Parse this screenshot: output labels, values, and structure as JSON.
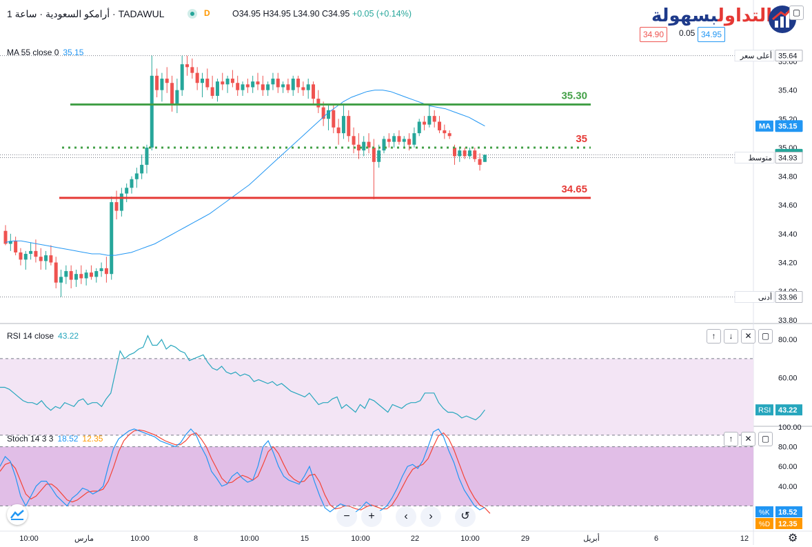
{
  "header": {
    "symbol_line": "أرامكو السعودية · ساعة 1 · TADAWUL",
    "status_letter": "D",
    "ohlc": {
      "o": "O34.95",
      "h": "H34.95",
      "l": "L34.90",
      "c": "C34.95",
      "chg": "+0.05 (+0.14%)"
    },
    "bid": "34.90",
    "spread": "0.05",
    "ask": "34.95",
    "logo_red": "التداول",
    "logo_blue": "بسهولة"
  },
  "colors": {
    "up": "#26a69a",
    "down": "#ef5350",
    "ma": "#2196f3",
    "rsi": "#26a6bd",
    "stoch_k": "#2196f3",
    "stoch_d": "#f44336",
    "green_line": "#43a047",
    "red_line": "#e53935",
    "band": "#e1bee7"
  },
  "legends": {
    "ma": {
      "label": "MA 55 close 0",
      "value": "35.15"
    },
    "rsi": {
      "label": "RSI 14 close",
      "value": "43.22"
    },
    "stoch": {
      "label": "Stoch 14 3 3",
      "k": "18.52",
      "d": "12.35"
    }
  },
  "price_axis_labels": {
    "high": "أعلى سعر",
    "avg": "متوسط",
    "low": "أدنى"
  },
  "chart_data": [
    {
      "type": "candlestick",
      "title": "",
      "ylim": [
        33.78,
        35.72
      ],
      "y_ticks": [
        33.8,
        34.0,
        34.2,
        34.4,
        34.6,
        34.8,
        35.0,
        35.2,
        35.4,
        35.6
      ],
      "x_tick_labels": [
        "10:00",
        "مارس",
        "10:00",
        "8",
        "10:00",
        "15",
        "10:00",
        "22",
        "10:00",
        "29",
        "أبريل",
        "6",
        "12"
      ],
      "bars": [
        {
          "o": 34.42,
          "h": 34.46,
          "l": 34.32,
          "c": 34.33
        },
        {
          "o": 34.33,
          "h": 34.4,
          "l": 34.28,
          "c": 34.35
        },
        {
          "o": 34.35,
          "h": 34.38,
          "l": 34.25,
          "c": 34.27
        },
        {
          "o": 34.27,
          "h": 34.3,
          "l": 34.18,
          "c": 34.22
        },
        {
          "o": 34.22,
          "h": 34.28,
          "l": 34.15,
          "c": 34.26
        },
        {
          "o": 34.26,
          "h": 34.34,
          "l": 34.22,
          "c": 34.28
        },
        {
          "o": 34.28,
          "h": 34.36,
          "l": 34.2,
          "c": 34.24
        },
        {
          "o": 34.24,
          "h": 34.3,
          "l": 34.15,
          "c": 34.21
        },
        {
          "o": 34.21,
          "h": 34.28,
          "l": 34.15,
          "c": 34.25
        },
        {
          "o": 34.25,
          "h": 34.32,
          "l": 34.18,
          "c": 34.2
        },
        {
          "o": 34.2,
          "h": 34.24,
          "l": 34.02,
          "c": 34.06
        },
        {
          "o": 34.06,
          "h": 34.15,
          "l": 33.96,
          "c": 34.1
        },
        {
          "o": 34.1,
          "h": 34.18,
          "l": 34.05,
          "c": 34.14
        },
        {
          "o": 34.14,
          "h": 34.18,
          "l": 34.02,
          "c": 34.08
        },
        {
          "o": 34.08,
          "h": 34.15,
          "l": 34.03,
          "c": 34.12
        },
        {
          "o": 34.12,
          "h": 34.18,
          "l": 34.05,
          "c": 34.09
        },
        {
          "o": 34.09,
          "h": 34.15,
          "l": 34.04,
          "c": 34.13
        },
        {
          "o": 34.13,
          "h": 34.18,
          "l": 34.08,
          "c": 34.1
        },
        {
          "o": 34.1,
          "h": 34.16,
          "l": 34.06,
          "c": 34.14
        },
        {
          "o": 34.14,
          "h": 34.2,
          "l": 34.1,
          "c": 34.16
        },
        {
          "o": 34.16,
          "h": 34.24,
          "l": 34.06,
          "c": 34.12
        },
        {
          "o": 34.12,
          "h": 34.66,
          "l": 34.08,
          "c": 34.62
        },
        {
          "o": 34.62,
          "h": 34.7,
          "l": 34.5,
          "c": 34.56
        },
        {
          "o": 34.56,
          "h": 34.72,
          "l": 34.52,
          "c": 34.68
        },
        {
          "o": 34.68,
          "h": 34.75,
          "l": 34.62,
          "c": 34.72
        },
        {
          "o": 34.72,
          "h": 34.8,
          "l": 34.68,
          "c": 34.78
        },
        {
          "o": 34.78,
          "h": 34.86,
          "l": 34.72,
          "c": 34.82
        },
        {
          "o": 34.82,
          "h": 34.95,
          "l": 34.78,
          "c": 34.88
        },
        {
          "o": 34.88,
          "h": 35.02,
          "l": 34.82,
          "c": 35.0
        },
        {
          "o": 35.0,
          "h": 35.64,
          "l": 34.98,
          "c": 35.5
        },
        {
          "o": 35.5,
          "h": 35.55,
          "l": 35.35,
          "c": 35.4
        },
        {
          "o": 35.4,
          "h": 35.52,
          "l": 35.32,
          "c": 35.48
        },
        {
          "o": 35.48,
          "h": 35.56,
          "l": 35.38,
          "c": 35.45
        },
        {
          "o": 35.45,
          "h": 35.5,
          "l": 35.25,
          "c": 35.3
        },
        {
          "o": 35.3,
          "h": 35.48,
          "l": 35.24,
          "c": 35.4
        },
        {
          "o": 35.4,
          "h": 35.64,
          "l": 35.36,
          "c": 35.58
        },
        {
          "o": 35.58,
          "h": 35.64,
          "l": 35.5,
          "c": 35.56
        },
        {
          "o": 35.56,
          "h": 35.62,
          "l": 35.48,
          "c": 35.52
        },
        {
          "o": 35.52,
          "h": 35.56,
          "l": 35.4,
          "c": 35.45
        },
        {
          "o": 35.45,
          "h": 35.52,
          "l": 35.35,
          "c": 35.48
        },
        {
          "o": 35.48,
          "h": 35.55,
          "l": 35.4,
          "c": 35.42
        },
        {
          "o": 35.42,
          "h": 35.5,
          "l": 35.34,
          "c": 35.36
        },
        {
          "o": 35.36,
          "h": 35.48,
          "l": 35.32,
          "c": 35.46
        },
        {
          "o": 35.46,
          "h": 35.52,
          "l": 35.4,
          "c": 35.44
        },
        {
          "o": 35.44,
          "h": 35.5,
          "l": 35.38,
          "c": 35.48
        },
        {
          "o": 35.48,
          "h": 35.54,
          "l": 35.42,
          "c": 35.45
        },
        {
          "o": 35.45,
          "h": 35.5,
          "l": 35.36,
          "c": 35.4
        },
        {
          "o": 35.4,
          "h": 35.46,
          "l": 35.36,
          "c": 35.44
        },
        {
          "o": 35.44,
          "h": 35.48,
          "l": 35.38,
          "c": 35.42
        },
        {
          "o": 35.42,
          "h": 35.5,
          "l": 35.38,
          "c": 35.46
        },
        {
          "o": 35.46,
          "h": 35.52,
          "l": 35.4,
          "c": 35.44
        },
        {
          "o": 35.44,
          "h": 35.5,
          "l": 35.36,
          "c": 35.4
        },
        {
          "o": 35.4,
          "h": 35.46,
          "l": 35.36,
          "c": 35.44
        },
        {
          "o": 35.44,
          "h": 35.52,
          "l": 35.4,
          "c": 35.48
        },
        {
          "o": 35.48,
          "h": 35.52,
          "l": 35.38,
          "c": 35.42
        },
        {
          "o": 35.42,
          "h": 35.46,
          "l": 35.38,
          "c": 35.44
        },
        {
          "o": 35.44,
          "h": 35.48,
          "l": 35.38,
          "c": 35.4
        },
        {
          "o": 35.4,
          "h": 35.5,
          "l": 35.36,
          "c": 35.48
        },
        {
          "o": 35.48,
          "h": 35.5,
          "l": 35.38,
          "c": 35.42
        },
        {
          "o": 35.42,
          "h": 35.46,
          "l": 35.36,
          "c": 35.4
        },
        {
          "o": 35.4,
          "h": 35.48,
          "l": 35.34,
          "c": 35.44
        },
        {
          "o": 35.44,
          "h": 35.46,
          "l": 35.3,
          "c": 35.34
        },
        {
          "o": 35.34,
          "h": 35.4,
          "l": 35.24,
          "c": 35.28
        },
        {
          "o": 35.28,
          "h": 35.32,
          "l": 35.15,
          "c": 35.2
        },
        {
          "o": 35.2,
          "h": 35.3,
          "l": 35.12,
          "c": 35.26
        },
        {
          "o": 35.26,
          "h": 35.3,
          "l": 35.1,
          "c": 35.14
        },
        {
          "o": 35.14,
          "h": 35.2,
          "l": 35.02,
          "c": 35.1
        },
        {
          "o": 35.1,
          "h": 35.3,
          "l": 35.06,
          "c": 35.22
        },
        {
          "o": 35.22,
          "h": 35.26,
          "l": 35.04,
          "c": 35.08
        },
        {
          "o": 35.08,
          "h": 35.14,
          "l": 34.96,
          "c": 35.02
        },
        {
          "o": 35.02,
          "h": 35.1,
          "l": 34.92,
          "c": 34.98
        },
        {
          "o": 34.98,
          "h": 35.08,
          "l": 34.94,
          "c": 35.04
        },
        {
          "o": 35.04,
          "h": 35.1,
          "l": 34.96,
          "c": 35.0
        },
        {
          "o": 35.0,
          "h": 35.06,
          "l": 34.64,
          "c": 34.9
        },
        {
          "o": 34.9,
          "h": 35.02,
          "l": 34.86,
          "c": 34.98
        },
        {
          "o": 34.98,
          "h": 35.08,
          "l": 34.96,
          "c": 35.06
        },
        {
          "o": 35.06,
          "h": 35.1,
          "l": 35.0,
          "c": 35.04
        },
        {
          "o": 35.04,
          "h": 35.1,
          "l": 35.0,
          "c": 35.08
        },
        {
          "o": 35.08,
          "h": 35.12,
          "l": 35.02,
          "c": 35.04
        },
        {
          "o": 35.04,
          "h": 35.08,
          "l": 35.0,
          "c": 35.06
        },
        {
          "o": 35.06,
          "h": 35.1,
          "l": 34.98,
          "c": 35.02
        },
        {
          "o": 35.02,
          "h": 35.14,
          "l": 35.0,
          "c": 35.1
        },
        {
          "o": 35.1,
          "h": 35.2,
          "l": 35.08,
          "c": 35.18
        },
        {
          "o": 35.18,
          "h": 35.22,
          "l": 35.12,
          "c": 35.16
        },
        {
          "o": 35.16,
          "h": 35.3,
          "l": 35.14,
          "c": 35.22
        },
        {
          "o": 35.22,
          "h": 35.26,
          "l": 35.14,
          "c": 35.18
        },
        {
          "o": 35.18,
          "h": 35.22,
          "l": 35.1,
          "c": 35.12
        },
        {
          "o": 35.12,
          "h": 35.16,
          "l": 35.06,
          "c": 35.1
        },
        {
          "o": 35.1,
          "h": 35.12,
          "l": 35.06,
          "c": 35.08
        },
        {
          "o": 35.0,
          "h": 35.02,
          "l": 34.88,
          "c": 34.94
        },
        {
          "o": 34.94,
          "h": 35.0,
          "l": 34.9,
          "c": 34.98
        },
        {
          "o": 34.98,
          "h": 35.0,
          "l": 34.92,
          "c": 34.94
        },
        {
          "o": 34.94,
          "h": 35.0,
          "l": 34.92,
          "c": 34.98
        },
        {
          "o": 34.98,
          "h": 35.0,
          "l": 34.9,
          "c": 34.92
        },
        {
          "o": 34.92,
          "h": 34.96,
          "l": 34.84,
          "c": 34.88
        },
        {
          "o": 34.9,
          "h": 34.95,
          "l": 34.9,
          "c": 34.95
        }
      ],
      "ma55": [
        34.34,
        34.35,
        34.35,
        34.34,
        34.33,
        34.32,
        34.31,
        34.3,
        34.29,
        34.28,
        34.27,
        34.26,
        34.26,
        34.25,
        34.25,
        34.26,
        34.27,
        34.29,
        34.31,
        34.33,
        34.36,
        34.39,
        34.42,
        34.45,
        34.48,
        34.51,
        34.54,
        34.58,
        34.62,
        34.66,
        34.7,
        34.74,
        34.79,
        34.84,
        34.89,
        34.94,
        34.99,
        35.04,
        35.09,
        35.14,
        35.19,
        35.24,
        35.28,
        35.32,
        35.35,
        35.37,
        35.39,
        35.4,
        35.4,
        35.39,
        35.37,
        35.35,
        35.33,
        35.31,
        35.29,
        35.28,
        35.27,
        35.25,
        35.23,
        35.21,
        35.18,
        35.15
      ],
      "ma55_start_bar": 0,
      "levels": [
        {
          "value": 35.3,
          "label": "35.30",
          "style": "solid",
          "color": "#43a047"
        },
        {
          "value": 35.0,
          "label": "35",
          "style": "dotted",
          "color": "#43a047",
          "label_color": "#e53935"
        },
        {
          "value": 34.65,
          "label": "34.65",
          "style": "solid",
          "color": "#e53935"
        }
      ],
      "axis_tags": [
        {
          "value": 35.64,
          "text": "35.64",
          "kind": "high"
        },
        {
          "value": 35.15,
          "text": "35.15",
          "kind": "ma",
          "prefix": "MA"
        },
        {
          "value": 34.95,
          "text": "34.95",
          "kind": "last"
        },
        {
          "value": 34.93,
          "text": "34.93",
          "kind": "avg"
        },
        {
          "value": 33.96,
          "text": "33.96",
          "kind": "low"
        }
      ]
    },
    {
      "type": "line",
      "name": "RSI",
      "ylim": [
        35,
        88
      ],
      "y_ticks": [
        60.0,
        80.0
      ],
      "band": [
        30,
        70
      ],
      "values": [
        55,
        55,
        54,
        52,
        50,
        48,
        47,
        47,
        46,
        48,
        45,
        43,
        45,
        44,
        47,
        46,
        45,
        48,
        49,
        46,
        47,
        47,
        45,
        49,
        52,
        63,
        74,
        70,
        72,
        73,
        75,
        76,
        82,
        77,
        77,
        80,
        75,
        77,
        76,
        74,
        73,
        69,
        70,
        71,
        72,
        68,
        65,
        64,
        66,
        63,
        62,
        63,
        61,
        62,
        61,
        58,
        59,
        58,
        57,
        58,
        56,
        57,
        55,
        53,
        52,
        51,
        50,
        52,
        49,
        46,
        47,
        47,
        49,
        50,
        44,
        46,
        44,
        42,
        46,
        44,
        49,
        48,
        46,
        44,
        42,
        46,
        45,
        44,
        46,
        47,
        47,
        48,
        52,
        52,
        52,
        47,
        44,
        42,
        42,
        41,
        39,
        40,
        39,
        38,
        40,
        43.22
      ],
      "last_tag": "43.22"
    },
    {
      "type": "line",
      "name": "Stoch",
      "ylim": [
        0,
        100
      ],
      "y_ticks": [
        40.0,
        60.0,
        80.0,
        100.0
      ],
      "band": [
        20,
        80
      ],
      "k": [
        60,
        70,
        65,
        50,
        30,
        20,
        30,
        40,
        45,
        45,
        38,
        30,
        25,
        20,
        28,
        32,
        38,
        36,
        32,
        35,
        40,
        60,
        78,
        88,
        92,
        96,
        98,
        96,
        94,
        92,
        90,
        86,
        84,
        82,
        80,
        84,
        92,
        98,
        92,
        80,
        70,
        55,
        48,
        40,
        42,
        50,
        54,
        48,
        44,
        46,
        60,
        80,
        86,
        74,
        60,
        50,
        46,
        44,
        42,
        50,
        60,
        44,
        30,
        18,
        14,
        18,
        22,
        20,
        16,
        14,
        18,
        24,
        20,
        14,
        16,
        20,
        28,
        38,
        50,
        60,
        62,
        58,
        66,
        80,
        95,
        98,
        90,
        76,
        64,
        48,
        36,
        28,
        20,
        16,
        18.52
      ],
      "d": [
        55,
        62,
        64,
        58,
        45,
        32,
        27,
        30,
        36,
        42,
        42,
        38,
        32,
        26,
        24,
        26,
        30,
        34,
        35,
        35,
        37,
        45,
        59,
        75,
        86,
        92,
        96,
        97,
        96,
        94,
        92,
        89,
        86,
        84,
        82,
        82,
        86,
        92,
        94,
        88,
        80,
        68,
        58,
        48,
        43,
        44,
        48,
        51,
        49,
        46,
        50,
        62,
        75,
        80,
        73,
        62,
        52,
        47,
        44,
        45,
        51,
        52,
        44,
        31,
        21,
        17,
        18,
        20,
        19,
        17,
        16,
        19,
        21,
        19,
        17,
        17,
        21,
        29,
        39,
        49,
        57,
        60,
        62,
        68,
        80,
        91,
        94,
        88,
        77,
        63,
        49,
        37,
        28,
        21,
        18,
        12.35
      ]
    }
  ]
}
